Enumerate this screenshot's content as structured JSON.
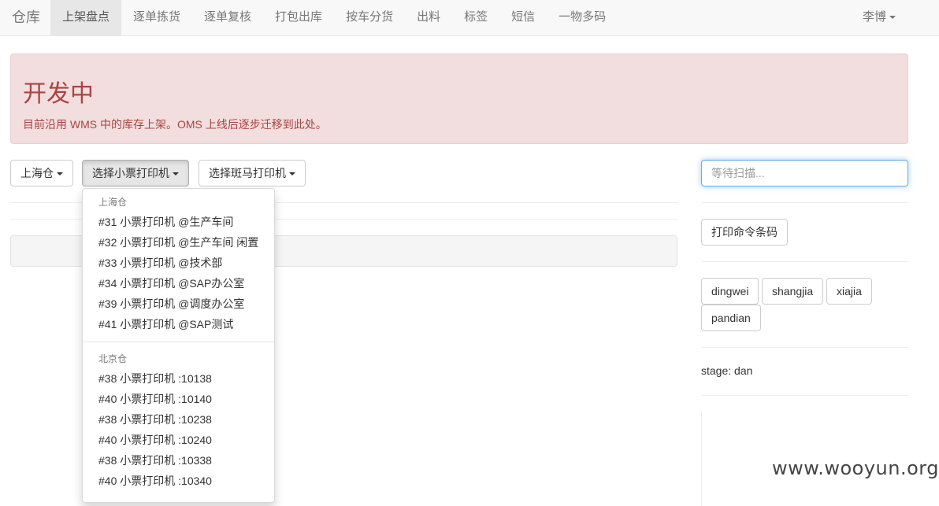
{
  "navbar": {
    "brand": "仓库",
    "items": [
      {
        "label": "上架盘点",
        "active": true
      },
      {
        "label": "逐单拣货",
        "active": false
      },
      {
        "label": "逐单复核",
        "active": false
      },
      {
        "label": "打包出库",
        "active": false
      },
      {
        "label": "按车分货",
        "active": false
      },
      {
        "label": "出料",
        "active": false
      },
      {
        "label": "标签",
        "active": false
      },
      {
        "label": "短信",
        "active": false
      },
      {
        "label": "一物多码",
        "active": false
      }
    ],
    "user": "李博"
  },
  "alert": {
    "title": "开发中",
    "message": "目前沿用 WMS 中的库存上架。OMS 上线后逐步迁移到此处。"
  },
  "toolbar": {
    "warehouse_label": "上海仓",
    "receipt_printer_label": "选择小票打印机",
    "zebra_printer_label": "选择斑马打印机"
  },
  "printer_dropdown": {
    "groups": [
      {
        "header": "上海仓",
        "items": [
          "#31 小票打印机 @生产车间",
          "#32 小票打印机 @生产车间 闲置",
          "#33 小票打印机 @技术部",
          "#34 小票打印机 @SAP办公室",
          "#39 小票打印机 @调度办公室",
          "#41 小票打印机 @SAP测试"
        ]
      },
      {
        "header": "北京仓",
        "items": [
          "#38 小票打印机 :10138",
          "#40 小票打印机 :10140",
          "#38 小票打印机 :10238",
          "#40 小票打印机 :10240",
          "#38 小票打印机 :10338",
          "#40 小票打印机 :10340"
        ]
      }
    ]
  },
  "sidebar": {
    "scan_placeholder": "等待扫描...",
    "print_command_label": "打印命令条码",
    "commands": [
      "dingwei",
      "shangjia",
      "xiajia",
      "pandian"
    ],
    "stage_text": "stage: dan"
  },
  "watermark": "www.wooyun.org"
}
